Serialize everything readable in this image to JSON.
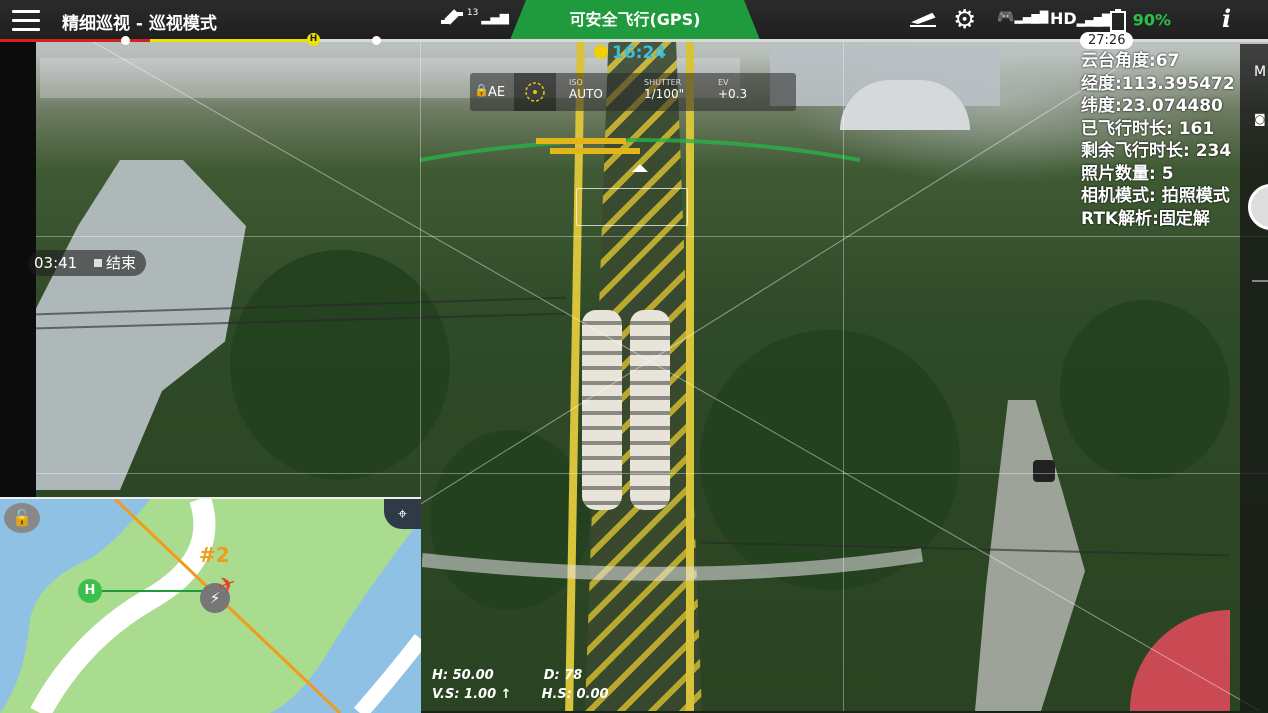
{
  "app": {
    "title": "精细巡视 - 巡视模式",
    "flight_status": "可安全飞行(GPS)",
    "satellite_count": "13",
    "hd_label": "HD",
    "battery": "90%",
    "timer_top": "27:26"
  },
  "progress": {
    "red_fraction": 0.12,
    "h_marker_label": "H"
  },
  "clock": "16:24",
  "exposure": {
    "ae": "AE",
    "iso_label": "ISO",
    "iso_value": "AUTO",
    "shutter_label": "SHUTTER",
    "shutter_value": "1/100\"",
    "ev_label": "EV",
    "ev_value": "+0.3"
  },
  "telemetry": {
    "gimbal": "云台角度:67",
    "longitude": "经度:113.395472",
    "latitude": "纬度:23.074480",
    "flown": "已飞行时长: 161",
    "remaining": "剩余飞行时长: 234",
    "photos": "照片数量: 5",
    "camera_mode": "相机模式: 拍照模式",
    "rtk": "RTK解析:固定解"
  },
  "recording": {
    "time": "03:41",
    "end_label": "结束"
  },
  "hud": {
    "h": "H: 50.00",
    "d": "D: 78",
    "vs": "V.S: 1.00 ↑",
    "hs": "H.S: 0.00"
  },
  "map": {
    "tower_label": "#2",
    "home_label": "H"
  },
  "right_panel": {
    "m_label": "M"
  },
  "colors": {
    "accent_green": "#1f9a3c",
    "battery_green": "#29c24a",
    "progress_red": "#d81e1e",
    "progress_yellow": "#f0e200",
    "clock_blue": "#3fbde0",
    "map_route": "#f29a1a"
  }
}
